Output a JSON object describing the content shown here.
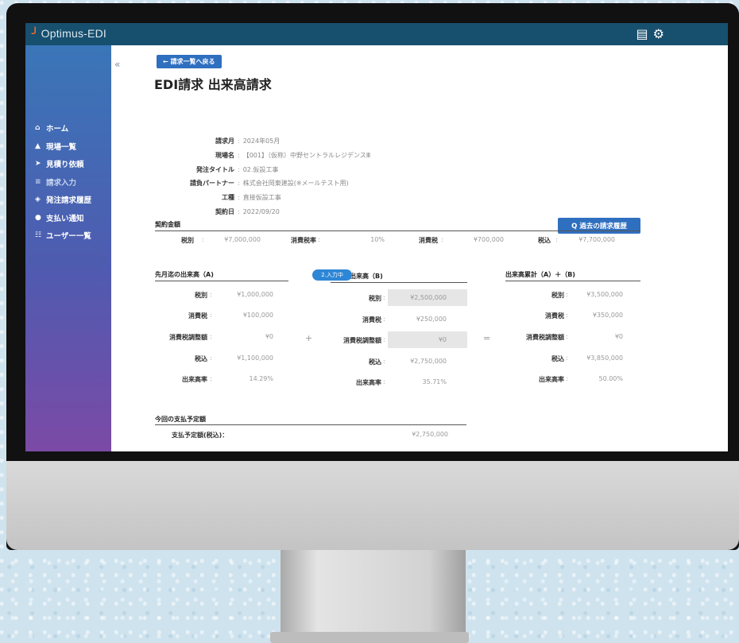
{
  "app": {
    "logo": "Optimus-EDI",
    "logo_mark": "╯"
  },
  "header_icons": {
    "book": "book-icon",
    "gear": "gear-icon"
  },
  "sidebar": {
    "collapse": "«",
    "items": [
      {
        "icon": "home-icon",
        "glyph": "⌂",
        "label": "ホーム"
      },
      {
        "icon": "site-icon",
        "glyph": "▲",
        "label": "現場一覧"
      },
      {
        "icon": "send-icon",
        "glyph": "➤",
        "label": "見積り依頼"
      },
      {
        "icon": "invoice-icon",
        "glyph": "≡",
        "label": "請求入力",
        "active": true
      },
      {
        "icon": "history-icon",
        "glyph": "◈",
        "label": "発注請求履歴"
      },
      {
        "icon": "notice-icon",
        "glyph": "●",
        "label": "支払い通知"
      },
      {
        "icon": "users-icon",
        "glyph": "☷",
        "label": "ユーザー一覧"
      }
    ]
  },
  "page": {
    "back": "← 請求一覧へ戻る",
    "title": "EDI請求 出来高請求",
    "history_btn": "Q 過去の請求履歴"
  },
  "info": [
    {
      "label": "請求月",
      "value": "2024年05月"
    },
    {
      "label": "現場名",
      "value": "【001】（仮称）中野セントラルレジデンスⅢ"
    },
    {
      "label": "発注タイトル",
      "value": "02.仮設工事"
    },
    {
      "label": "請負パートナー",
      "value": "株式会社岡東建設(※メールテスト用)"
    },
    {
      "label": "工種",
      "value": "直接仮設工事"
    },
    {
      "label": "契約日",
      "value": "2022/09/20"
    }
  ],
  "contract": {
    "section": "契約金額",
    "l_tax_ex": "税別",
    "tax_ex": "¥7,000,000",
    "l_rate": "消費税率",
    "rate": "10%",
    "l_tax": "消費税",
    "tax": "¥700,000",
    "l_tax_in": "税込",
    "tax_in": "¥7,700,000"
  },
  "col_a": {
    "title": "先月迄の出来高（A)",
    "rows": [
      {
        "label": "税別",
        "value": "¥1,000,000"
      },
      {
        "label": "消費税",
        "value": "¥100,000"
      },
      {
        "label": "消費税調整額",
        "value": "¥0"
      },
      {
        "label": "税込",
        "value": "¥1,100,000"
      },
      {
        "label": "出来高率",
        "value": "14.29%"
      }
    ]
  },
  "col_b": {
    "title": "今回の出来高（B)",
    "status": "2.入力中",
    "rows": [
      {
        "label": "税別",
        "value": "¥2,500,000"
      },
      {
        "label": "消費税",
        "value": "¥250,000"
      },
      {
        "label": "消費税調整額",
        "value": "¥0"
      },
      {
        "label": "税込",
        "value": "¥2,750,000"
      },
      {
        "label": "出来高率",
        "value": "35.71%"
      }
    ]
  },
  "col_c": {
    "title": "出来高累計（A）＋（B)",
    "rows": [
      {
        "label": "税別",
        "value": "¥3,500,000"
      },
      {
        "label": "消費税",
        "value": "¥350,000"
      },
      {
        "label": "消費税調整額",
        "value": "¥0"
      },
      {
        "label": "税込",
        "value": "¥3,850,000"
      },
      {
        "label": "出来高率",
        "value": "50.00%"
      }
    ]
  },
  "ops": {
    "plus": "+",
    "equals": "="
  },
  "payment": {
    "section": "今回の支払予定額",
    "label": "支払予定額(税込)：",
    "value": "¥2,750,000"
  }
}
